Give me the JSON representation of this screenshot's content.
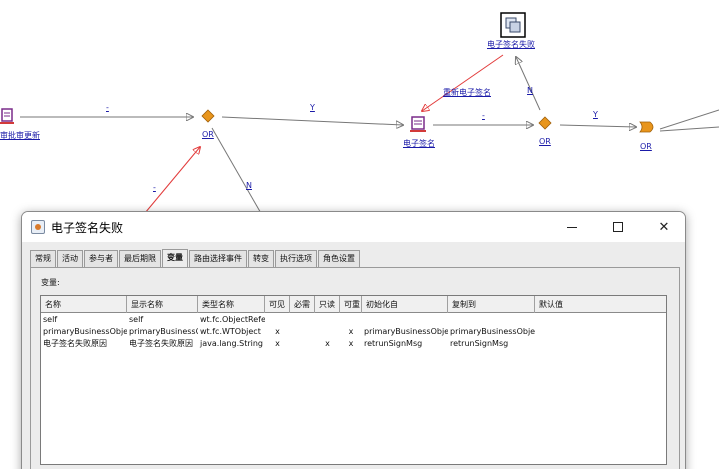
{
  "workflow": {
    "nodes": {
      "left_task": "审批审更新",
      "or1": "OR",
      "sign_task": "电子签名",
      "or2": "OR",
      "fail_task": "电子签名失败",
      "or3": "OR"
    },
    "edges": {
      "e1": "-",
      "e2": "Y",
      "e3": "-",
      "e4": "Y",
      "e5": "N",
      "e6": "N",
      "e7": "-",
      "resign": "重新电子签名"
    }
  },
  "dialog": {
    "title": "电子签名失败",
    "tabs": [
      "常规",
      "活动",
      "参与者",
      "最后期限",
      "变量",
      "路由选择事件",
      "转变",
      "执行选项",
      "角色设置"
    ],
    "active_tab": "变量",
    "section_label": "变量:",
    "columns": [
      "名称",
      "显示名称",
      "类型名称",
      "可见",
      "必需",
      "只读",
      "可重",
      "初始化自",
      "复制到",
      "默认值"
    ],
    "rows": [
      [
        "self",
        "self",
        "wt.fc.ObjectReference",
        "",
        "",
        "",
        "",
        "",
        "",
        ""
      ],
      [
        "primaryBusinessObject",
        "primaryBusinessObject",
        "wt.fc.WTObject",
        "x",
        "",
        "",
        "x",
        "primaryBusinessObject",
        "primaryBusinessObject",
        ""
      ],
      [
        "电子签名失败原因",
        "电子签名失败原因",
        "java.lang.String",
        "x",
        "",
        "x",
        "x",
        "retrunSignMsg",
        "retrunSignMsg",
        ""
      ]
    ]
  },
  "colors": {
    "link_blue": "#1a1aa8",
    "diamond_orange": "#e8951c",
    "red_edge": "#e23a3a"
  }
}
